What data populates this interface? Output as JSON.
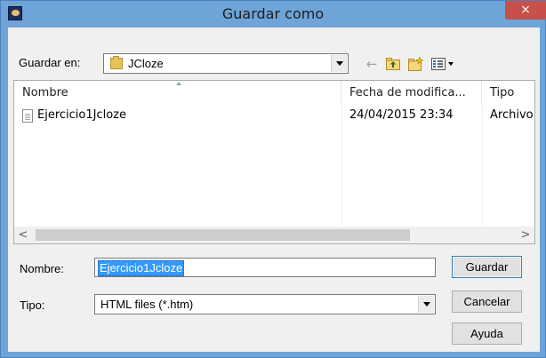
{
  "window": {
    "title": "Guardar como",
    "close_glyph": "×",
    "icon": "jcloze-app-icon"
  },
  "location": {
    "label": "Guardar en:",
    "value": "JCloze",
    "icon": "folder-icon"
  },
  "toolbar": {
    "back_glyph": "←",
    "up_glyph": "⮑",
    "newfolder_glyph": "✱",
    "view_glyph": "▦▾"
  },
  "file_list": {
    "columns": [
      "Nombre",
      "Fecha de modifica...",
      "Tipo"
    ],
    "rows": [
      {
        "name": "Ejercicio1Jcloze",
        "date": "24/04/2015 23:34",
        "type": "Archivo"
      }
    ],
    "scroll_left_glyph": "<",
    "scroll_right_glyph": ">"
  },
  "form": {
    "name_label": "Nombre:",
    "name_value": "Ejercicio1Jcloze",
    "type_label": "Tipo:",
    "type_value": "HTML files (*.htm)"
  },
  "buttons": {
    "save": "Guardar",
    "cancel": "Cancelar",
    "help": "Ayuda"
  },
  "colors": {
    "titlebar": "#6fa4d9",
    "close_button": "#c7504a",
    "selection": "#3399ff",
    "dialog_bg": "#f0f0f0"
  }
}
